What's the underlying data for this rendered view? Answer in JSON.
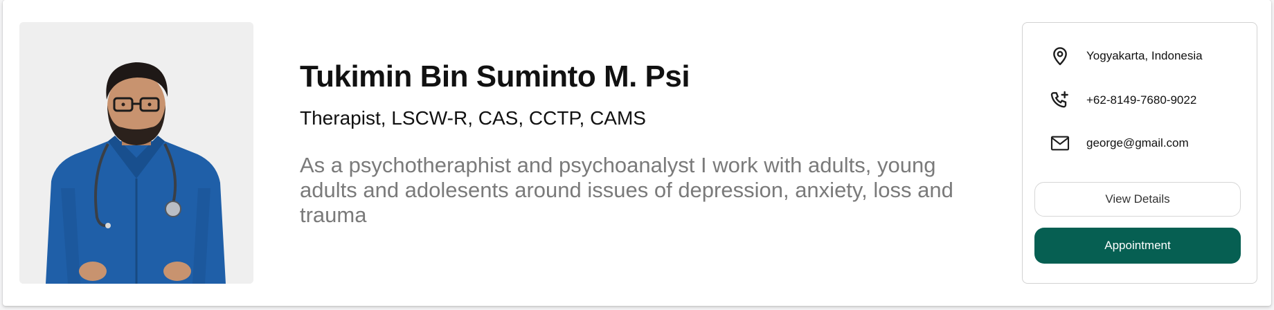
{
  "profile": {
    "name": "Tukimin Bin Suminto M. Psi",
    "credentials": "Therapist, LSCW-R, CAS, CCTP, CAMS",
    "bio": "As a psychotheraphist and psychoanalyst I work with adults, young adults and adolesents around issues of depression, anxiety, loss and trauma"
  },
  "contact": {
    "location": {
      "icon": "map-pin-icon",
      "text": "Yogyakarta, Indonesia"
    },
    "phone": {
      "icon": "phone-plus-icon",
      "text": "+62-8149-7680-9022"
    },
    "email": {
      "icon": "mail-icon",
      "text": "george@gmail.com"
    }
  },
  "actions": {
    "details_label": "View Details",
    "appointment_label": "Appointment"
  },
  "colors": {
    "accent": "#065f52",
    "bio_text": "#7a7a7a",
    "photo_bg": "#efefef"
  }
}
